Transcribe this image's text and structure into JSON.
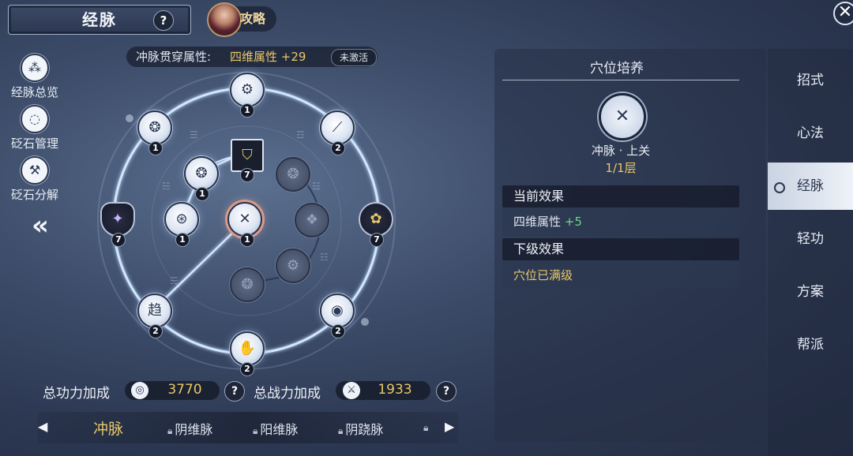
{
  "header": {
    "title": "经脉",
    "help": "?",
    "guide_label": "攻略",
    "close": "✕"
  },
  "banner": {
    "label": "冲脉贯穿属性:",
    "value": "四维属性 +29",
    "badge": "未激活"
  },
  "left_menu": [
    {
      "icon": "network-icon",
      "glyph": "⁂",
      "label": "经脉总览"
    },
    {
      "icon": "cycle-icon",
      "glyph": "◌",
      "label": "砭石管理"
    },
    {
      "icon": "hammer-icon",
      "glyph": "⚒",
      "label": "砭石分解"
    }
  ],
  "graph": {
    "nodes": [
      {
        "id": "n-top",
        "style": "white",
        "badge": "1"
      },
      {
        "id": "n-topright",
        "style": "white",
        "badge": "2"
      },
      {
        "id": "n-right",
        "style": "dark-gold",
        "badge": "7"
      },
      {
        "id": "n-botright",
        "style": "white",
        "badge": "2"
      },
      {
        "id": "n-bottom",
        "style": "white",
        "badge": "2"
      },
      {
        "id": "n-botleft",
        "style": "white",
        "badge": "2"
      },
      {
        "id": "n-left",
        "style": "dark-purple",
        "badge": "7"
      },
      {
        "id": "n-topleft",
        "style": "white",
        "badge": "1"
      },
      {
        "id": "n-center",
        "style": "white-selected",
        "badge": "1"
      },
      {
        "id": "n-inner-tl",
        "style": "white",
        "badge": "1"
      },
      {
        "id": "n-inner-l",
        "style": "white",
        "badge": "1"
      },
      {
        "id": "n-inner-top",
        "style": "square-gold",
        "badge": "7"
      },
      {
        "id": "n-inner-tr",
        "style": "dim",
        "badge": ""
      },
      {
        "id": "n-inner-r",
        "style": "dim",
        "badge": ""
      },
      {
        "id": "n-inner-br",
        "style": "dim",
        "badge": ""
      },
      {
        "id": "n-inner-b",
        "style": "dim",
        "badge": ""
      }
    ]
  },
  "panel": {
    "title": "穴位培养",
    "acupoint_name": "冲脉 · 上关",
    "acupoint_level": "1/1层",
    "current_effect_title": "当前效果",
    "current_effect_label": "四维属性",
    "current_effect_value": "+5",
    "next_effect_title": "下级效果",
    "next_effect_text": "穴位已满级"
  },
  "right_tabs": [
    {
      "label": "招式",
      "active": false
    },
    {
      "label": "心法",
      "active": false
    },
    {
      "label": "经脉",
      "active": true
    },
    {
      "label": "轻功",
      "active": false
    },
    {
      "label": "方案",
      "active": false
    },
    {
      "label": "帮派",
      "active": false
    }
  ],
  "stats": {
    "total_power_label": "总功力加成",
    "total_power_value": "3770",
    "total_combat_label": "总战力加成",
    "total_combat_value": "1933"
  },
  "bottom_tabs": [
    {
      "label": "冲脉",
      "locked": false,
      "active": true
    },
    {
      "label": "阴维脉",
      "locked": true,
      "active": false
    },
    {
      "label": "阳维脉",
      "locked": true,
      "active": false
    },
    {
      "label": "阴跷脉",
      "locked": true,
      "active": false
    }
  ],
  "colors": {
    "accent_gold": "#e9c76a",
    "effect_green": "#6fd48c",
    "ring_glow": "#bfe0ff"
  }
}
